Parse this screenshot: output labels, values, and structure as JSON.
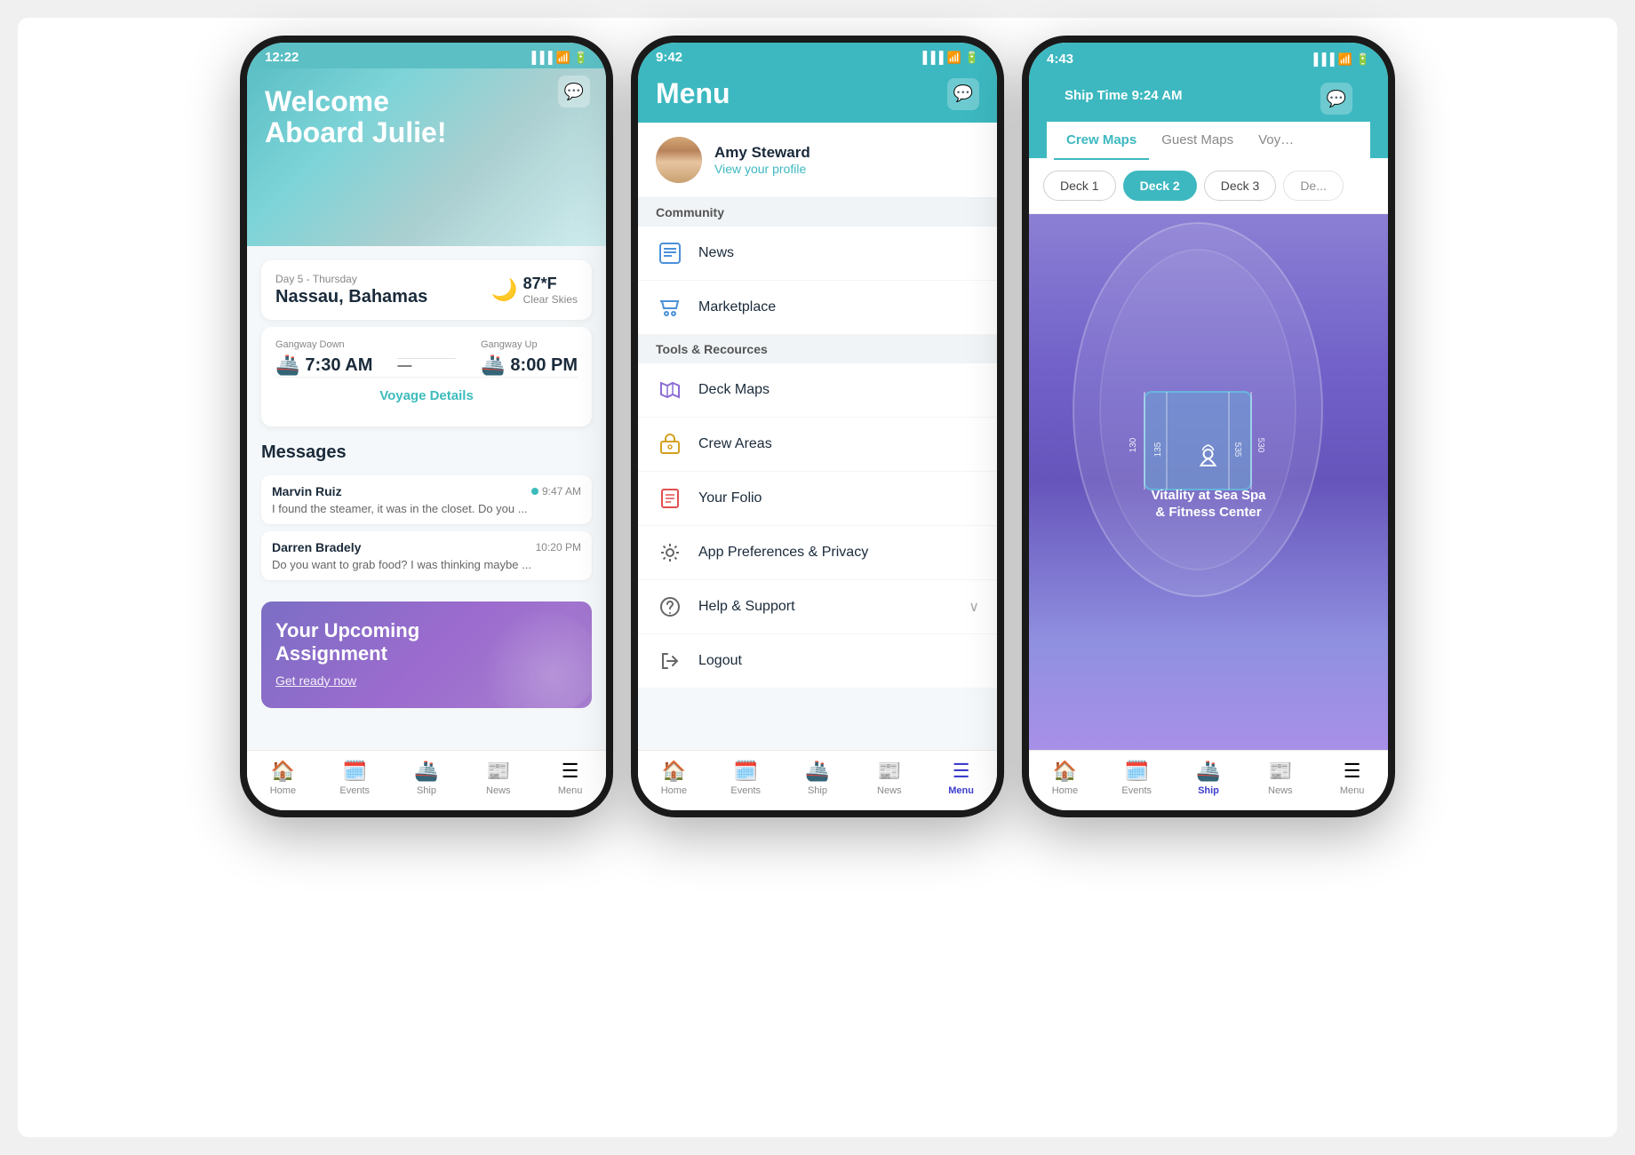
{
  "phone1": {
    "status_time": "12:22",
    "welcome": "Welcome\nAboard Julie!",
    "chat_icon": "💬",
    "day": {
      "label": "Day 5 - Thursday",
      "location": "Nassau, Bahamas",
      "weather_icon": "🌙",
      "temp": "87*F",
      "desc": "Clear Skies"
    },
    "gangway_down_label": "Gangway Down",
    "gangway_down_time": "7:30 AM",
    "gangway_up_label": "Gangway Up",
    "gangway_up_time": "8:00 PM",
    "voyage_link": "Voyage Details",
    "messages_title": "Messages",
    "messages": [
      {
        "name": "Marvin Ruiz",
        "time": "9:47 AM",
        "preview": "I found the steamer, it was in the closet. Do you ...",
        "unread": true
      },
      {
        "name": "Darren Bradely",
        "time": "10:20 PM",
        "preview": "Do you want to grab food? I was thinking maybe ...",
        "unread": false
      }
    ],
    "assignment_title": "Your Upcoming\nAssignment",
    "assignment_link": "Get ready now",
    "nav": [
      {
        "icon": "🏠",
        "label": "Home",
        "active": false
      },
      {
        "icon": "➕",
        "label": "Events",
        "active": false
      },
      {
        "icon": "🚢",
        "label": "Ship",
        "active": false
      },
      {
        "icon": "📰",
        "label": "News",
        "active": false
      },
      {
        "icon": "☰",
        "label": "Menu",
        "active": false
      }
    ]
  },
  "phone2": {
    "status_time": "9:42",
    "menu_title": "Menu",
    "chat_icon": "💬",
    "profile": {
      "name": "Amy Steward",
      "link": "View your profile"
    },
    "sections": [
      {
        "header": "Community",
        "items": [
          {
            "icon": "📰",
            "label": "News",
            "color": "#5b9bd5"
          },
          {
            "icon": "🛍️",
            "label": "Marketplace",
            "color": "#5b9bd5"
          }
        ]
      },
      {
        "header": "Tools & Recources",
        "items": [
          {
            "icon": "🗺️",
            "label": "Deck Maps",
            "color": "#8b6bd5"
          },
          {
            "icon": "🔑",
            "label": "Crew Areas",
            "color": "#d4a020"
          },
          {
            "icon": "💳",
            "label": "Your Folio",
            "color": "#e05050"
          },
          {
            "icon": "⚙️",
            "label": "App Preferences & Privacy",
            "color": "#666"
          },
          {
            "icon": "❓",
            "label": "Help & Support",
            "color": "#666",
            "chevron": "∨"
          },
          {
            "icon": "🚪",
            "label": "Logout",
            "color": "#666"
          }
        ]
      }
    ],
    "nav": [
      {
        "icon": "🏠",
        "label": "Home",
        "active": false
      },
      {
        "icon": "➕",
        "label": "Events",
        "active": false
      },
      {
        "icon": "🚢",
        "label": "Ship",
        "active": false
      },
      {
        "icon": "📰",
        "label": "News",
        "active": false
      },
      {
        "icon": "☰",
        "label": "Menu",
        "active": true
      }
    ]
  },
  "phone3": {
    "status_time": "4:43",
    "ship_time": "Ship Time 9:24 AM",
    "chat_icon": "💬",
    "tabs": [
      {
        "label": "Crew Maps",
        "active": true
      },
      {
        "label": "Guest Maps",
        "active": false
      },
      {
        "label": "Voyage",
        "active": false
      }
    ],
    "decks": [
      {
        "label": "Deck 1",
        "active": false
      },
      {
        "label": "Deck 2",
        "active": true
      },
      {
        "label": "Deck 3",
        "active": false
      },
      {
        "label": "De...",
        "active": false
      }
    ],
    "map_area": {
      "spa_icon": "✿",
      "spa_name": "Vitality at Sea Spa\n& Fitness Center",
      "room_numbers": [
        "130",
        "135",
        "535",
        "530"
      ]
    },
    "nav": [
      {
        "icon": "🏠",
        "label": "Home",
        "active": false
      },
      {
        "icon": "➕",
        "label": "Events",
        "active": false
      },
      {
        "icon": "🚢",
        "label": "Ship",
        "active": true
      },
      {
        "icon": "📰",
        "label": "News",
        "active": false
      },
      {
        "icon": "☰",
        "label": "Menu",
        "active": false
      }
    ]
  }
}
